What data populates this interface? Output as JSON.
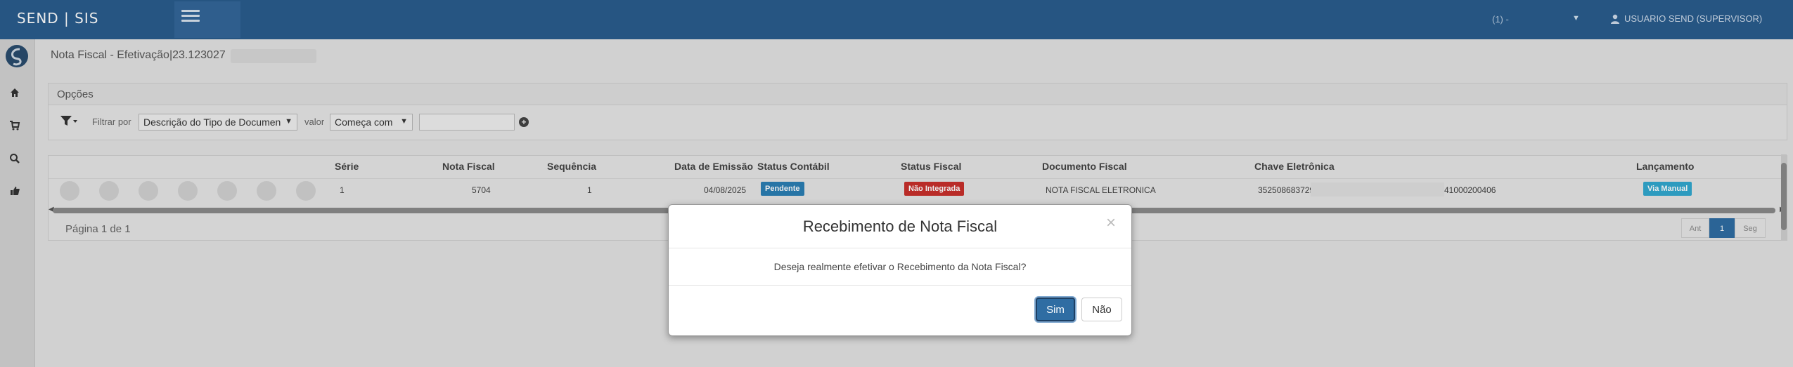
{
  "header": {
    "brand": "SEND | SIS",
    "selector_text": "(1) -",
    "user_label": "USUARIO SEND (SUPERVISOR)"
  },
  "sidebar": {
    "items": [
      "home-icon",
      "cart-icon",
      "search-icon",
      "thumbs-up-icon"
    ]
  },
  "page": {
    "title": "Nota Fiscal - Efetivação|23.123027"
  },
  "options": {
    "panel_title": "Opções",
    "filter_by_label": "Filtrar por",
    "filter_by_value": "Descrição do Tipo de Documen",
    "value_label": "valor",
    "operator_value": "Começa com",
    "search_value": ""
  },
  "table": {
    "columns": [
      "Série",
      "Nota Fiscal",
      "Sequência",
      "Data de Emissão",
      "Status Contábil",
      "Status Fiscal",
      "Documento Fiscal",
      "Chave Eletrônica",
      "Lançamento"
    ],
    "rows": [
      {
        "serie": "1",
        "nota_fiscal": "5704",
        "sequencia": "1",
        "data_emissao": "04/08/2025",
        "status_contabil": "Pendente",
        "status_fiscal": "Não Integrada",
        "documento_fiscal": "NOTA FISCAL ELETRONICA",
        "chave_start": "352508683729",
        "chave_end": "41000200406",
        "lancamento": "Via Manual"
      }
    ]
  },
  "pager": {
    "label": "Página 1 de 1",
    "prev": "Ant",
    "current": "1",
    "next": "Seg"
  },
  "modal": {
    "title": "Recebimento de Nota Fiscal",
    "close": "×",
    "message": "Deseja realmente efetivar o Recebimento da Nota Fiscal?",
    "yes_label": "Sim",
    "no_label": "Não"
  },
  "colors": {
    "topbar": "#2a5d8e",
    "primary_button": "#2f6da3",
    "badge_pendente": "#2b7fb5",
    "badge_nao_integrada": "#c9302c",
    "badge_via_manual": "#31a9d0"
  }
}
